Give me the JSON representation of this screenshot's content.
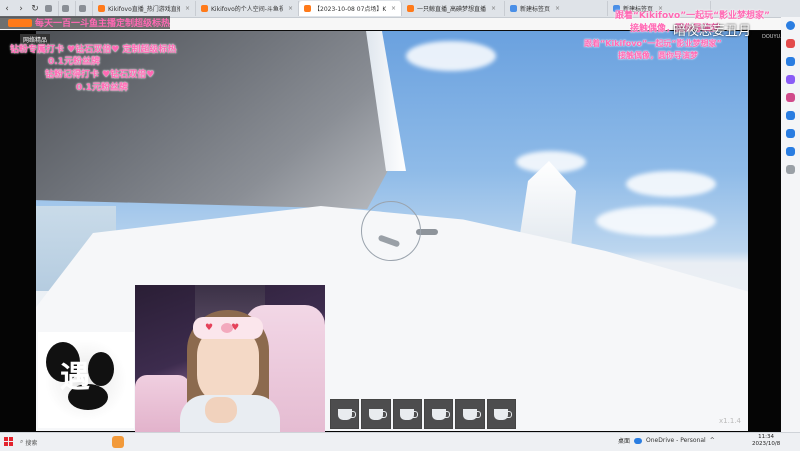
{
  "browser": {
    "tabs": [
      {
        "label": "",
        "color": "#8a8f96"
      },
      {
        "label": "",
        "color": "#8a8f96"
      },
      {
        "label": "",
        "color": "#8a8f96"
      },
      {
        "label": "Kikifovo直播_热门游戏直播_斗",
        "color": "#ff7a1a"
      },
      {
        "label": "Kikifovo的个人空间-斗鱼视频",
        "color": "#ff7a1a"
      },
      {
        "label": "【2023-10-08 07点场】Kik",
        "color": "#ff7a1a",
        "active": true
      },
      {
        "label": "一只鲸直播_高碘梦想直播",
        "color": "#ff7a1a"
      },
      {
        "label": "新建标签页",
        "color": "#4a8fe7"
      },
      {
        "label": "新建标签页",
        "color": "#4a8fe7"
      }
    ],
    "url_hint": "logk",
    "brand_text": "每天一百一斗鱼主播定制超级标热"
  },
  "overlay": {
    "tl_tag": "网络精品",
    "tl_line1": "钻粉专属打卡 ♥钻石双倍♥ 定制超级标热",
    "tl_line2": "0.1元粉丝牌",
    "tl_line3": "钻粉记得打卡 ♥钻石双倍♥",
    "tl_line4": "0.1元粉丝牌",
    "tr_line1": "跟着“Kikifovo”一起玩“影业梦想家”",
    "tr_line2": "接触偶像，圆你导演梦",
    "tr_line3": "跟着“Kikifovo”一起玩“影业梦想家”",
    "tr_line4": "接触偶像，圆你导演梦",
    "watermark": "暗夜忘妄丑月",
    "douyu": "DOUYU.COM"
  },
  "game": {
    "hotbar_value": "x1.1.4",
    "slots": 6
  },
  "logo": {
    "text": "遇"
  },
  "taskbar": {
    "search_label": "搜索",
    "tray_label": "桌面",
    "onedrive": "OneDrive - Personal",
    "time": "11:34",
    "date": "2023/10/8"
  },
  "colors": {
    "accent_pink": "#ff69b4",
    "douyu_orange": "#ff7a1a",
    "windows_red": "#e3232d"
  }
}
